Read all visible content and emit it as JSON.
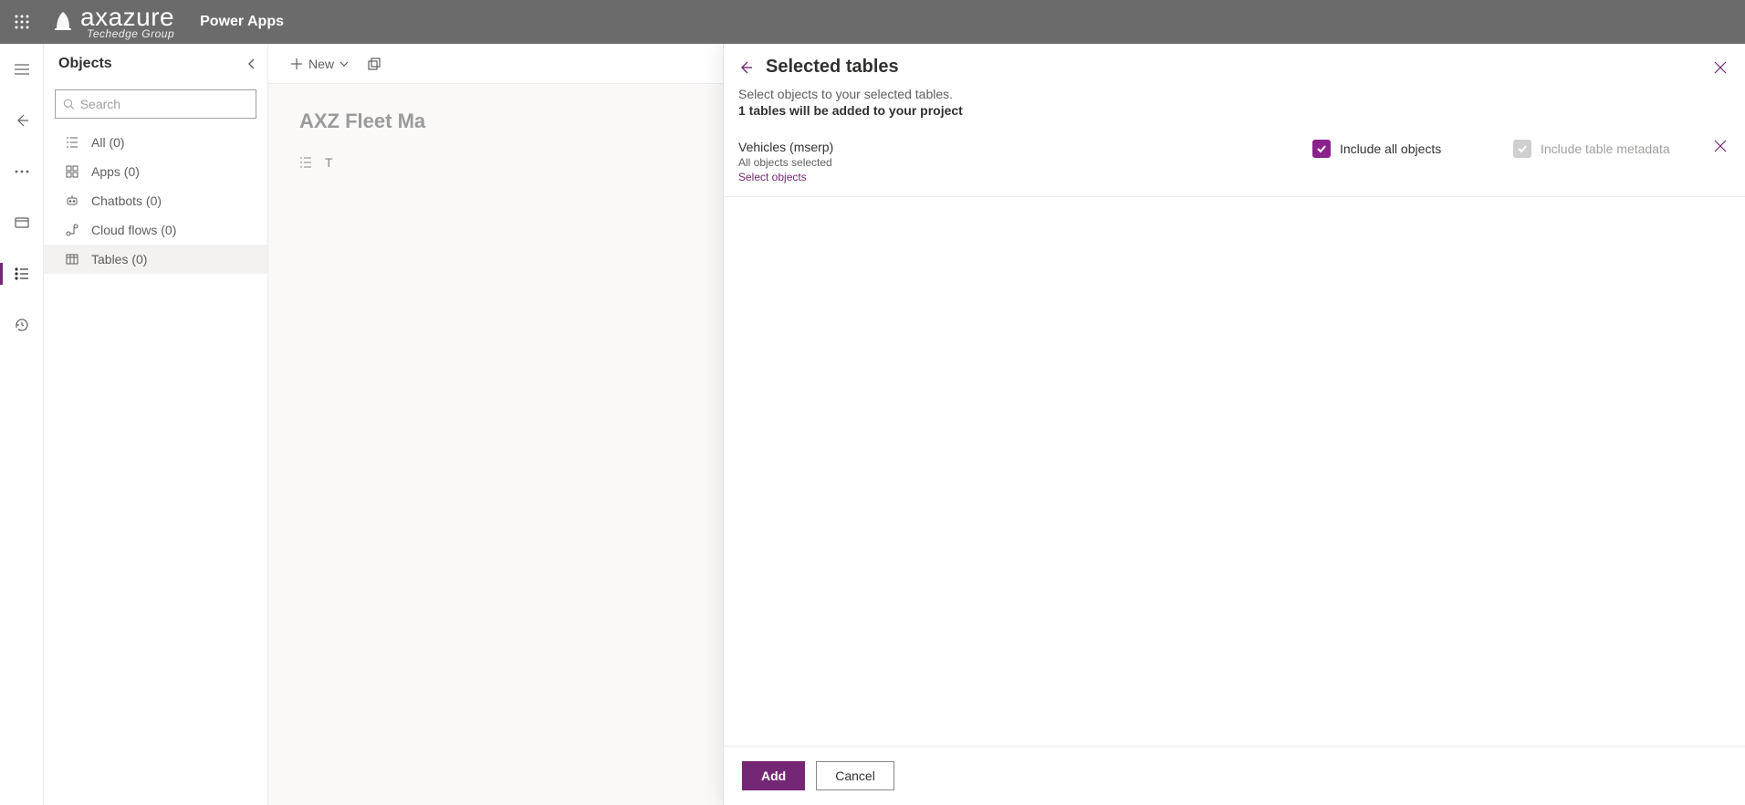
{
  "header": {
    "brand": "axazure",
    "tagline": "Techedge Group",
    "product": "Power Apps"
  },
  "objects_panel": {
    "title": "Objects",
    "search_placeholder": "Search",
    "items": [
      {
        "label": "All  (0)"
      },
      {
        "label": "Apps  (0)"
      },
      {
        "label": "Chatbots  (0)"
      },
      {
        "label": "Cloud flows  (0)"
      },
      {
        "label": "Tables  (0)"
      }
    ]
  },
  "commandbar": {
    "new_label": "New"
  },
  "main": {
    "solution_title": "AXZ Fleet Ma",
    "mini": "T"
  },
  "flyout": {
    "title": "Selected tables",
    "subtitle": "Select objects to your selected tables.",
    "note": "1 tables will be added to your project",
    "table": {
      "name": "Vehicles (mserp)",
      "hint": "All objects selected",
      "link": "Select objects",
      "include_all": "Include all objects",
      "include_meta": "Include table metadata"
    },
    "buttons": {
      "add": "Add",
      "cancel": "Cancel"
    }
  }
}
